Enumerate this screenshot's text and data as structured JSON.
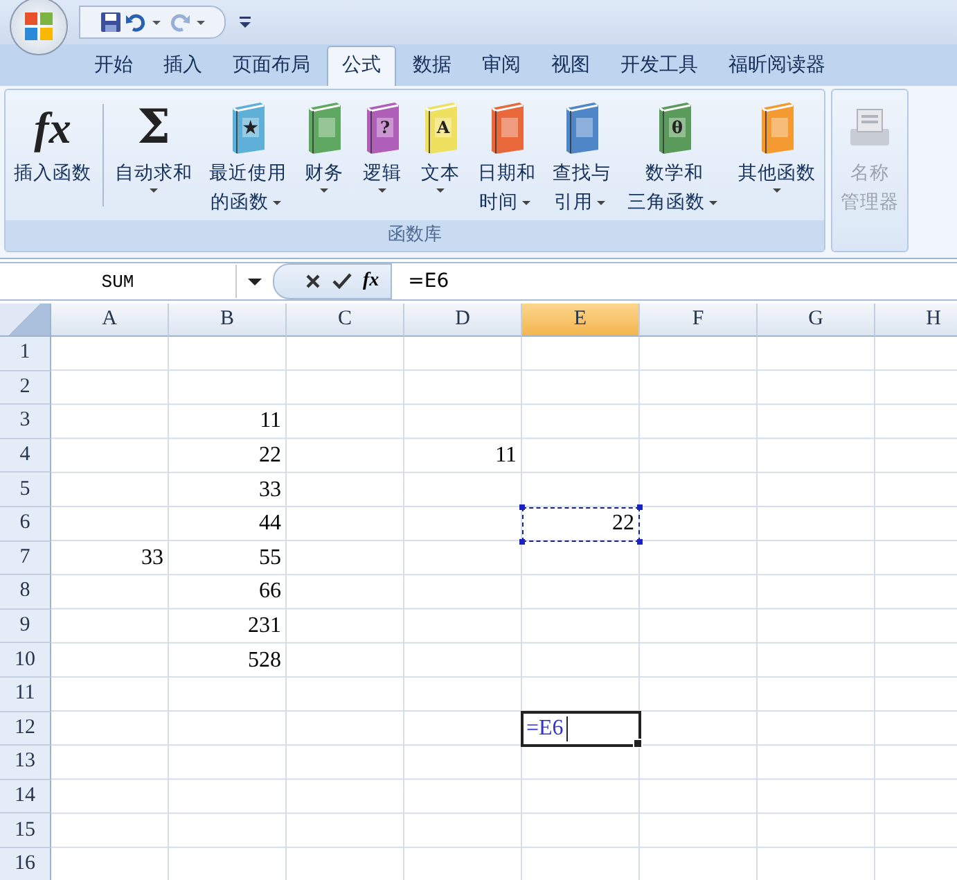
{
  "quick_access": {
    "buttons": [
      {
        "kind": "save",
        "disabled": false
      },
      {
        "kind": "undo",
        "disabled": false
      },
      {
        "kind": "redo",
        "disabled": true
      }
    ]
  },
  "ribbon_tabs": [
    {
      "label": "开始",
      "selected": false
    },
    {
      "label": "插入",
      "selected": false
    },
    {
      "label": "页面布局",
      "selected": false
    },
    {
      "label": "公式",
      "selected": true
    },
    {
      "label": "数据",
      "selected": false
    },
    {
      "label": "审阅",
      "selected": false
    },
    {
      "label": "视图",
      "selected": false
    },
    {
      "label": "开发工具",
      "selected": false
    },
    {
      "label": "福昕阅读器",
      "selected": false
    }
  ],
  "ribbon_groups": [
    {
      "label": "函数库",
      "buttons": [
        {
          "kind": "fx",
          "glyph": "fx",
          "lines": [
            "插入函数"
          ],
          "dropdown": false,
          "disabled": false
        },
        {
          "kind": "sum",
          "glyph": "Σ",
          "lines": [
            "自动求和"
          ],
          "dropdown": true,
          "disabled": false
        },
        {
          "kind": "book",
          "color": "#5fb0d8",
          "glyph": "★",
          "lines": [
            "最近使用",
            "的函数"
          ],
          "dropdown": true,
          "disabled": false
        },
        {
          "kind": "book",
          "color": "#5fa862",
          "lines": [
            "财务"
          ],
          "dropdown": true,
          "disabled": false
        },
        {
          "kind": "book",
          "color": "#b05fb8",
          "glyph": "?",
          "lines": [
            "逻辑"
          ],
          "dropdown": true,
          "disabled": false
        },
        {
          "kind": "book",
          "color": "#f0e060",
          "glyph": "A",
          "lines": [
            "文本"
          ],
          "dropdown": true,
          "disabled": false
        },
        {
          "kind": "book",
          "color": "#e8683c",
          "lines": [
            "日期和",
            "时间"
          ],
          "dropdown": true,
          "disabled": false
        },
        {
          "kind": "book",
          "color": "#4f86c8",
          "lines": [
            "查找与",
            "引用"
          ],
          "dropdown": true,
          "disabled": false
        },
        {
          "kind": "book",
          "color": "#5a9a5a",
          "glyph": "θ",
          "lines": [
            "数学和",
            "三角函数"
          ],
          "dropdown": true,
          "disabled": false
        },
        {
          "kind": "book",
          "color": "#f39a30",
          "lines": [
            "其他函数"
          ],
          "dropdown": true,
          "disabled": false
        }
      ]
    },
    {
      "buttons": [
        {
          "kind": "names",
          "lines": [
            "名称",
            "管理器"
          ],
          "dropdown": false,
          "disabled": true
        }
      ]
    }
  ],
  "formula_bar": {
    "name_box": "SUM",
    "function_glyph": "fx",
    "formula": "=E6"
  },
  "sheet": {
    "columns": [
      {
        "label": "A",
        "selected": false
      },
      {
        "label": "B",
        "selected": false
      },
      {
        "label": "C",
        "selected": false
      },
      {
        "label": "D",
        "selected": false
      },
      {
        "label": "E",
        "selected": true
      },
      {
        "label": "F",
        "selected": false
      },
      {
        "label": "G",
        "selected": false
      },
      {
        "label": "H",
        "selected": false
      }
    ],
    "rows": [
      {
        "header": "1",
        "cells": []
      },
      {
        "header": "2",
        "cells": []
      },
      {
        "header": "3",
        "cells": [
          null,
          "11"
        ]
      },
      {
        "header": "4",
        "cells": [
          null,
          "22",
          null,
          "11"
        ]
      },
      {
        "header": "5",
        "cells": [
          null,
          "33"
        ]
      },
      {
        "header": "6",
        "cells": [
          null,
          "44",
          null,
          null,
          {
            "text": "22",
            "kind": "copy-source"
          }
        ]
      },
      {
        "header": "7",
        "cells": [
          "33",
          "55"
        ]
      },
      {
        "header": "8",
        "cells": [
          null,
          "66"
        ]
      },
      {
        "header": "9",
        "cells": [
          null,
          "231"
        ]
      },
      {
        "header": "10",
        "cells": [
          null,
          "528"
        ]
      },
      {
        "header": "11",
        "cells": []
      },
      {
        "header": "12",
        "cells": [
          null,
          null,
          null,
          null,
          {
            "text": "=E6",
            "kind": "editing"
          }
        ]
      },
      {
        "header": "13",
        "cells": []
      },
      {
        "header": "14",
        "cells": []
      },
      {
        "header": "15",
        "cells": []
      },
      {
        "header": "16",
        "cells": []
      }
    ]
  }
}
